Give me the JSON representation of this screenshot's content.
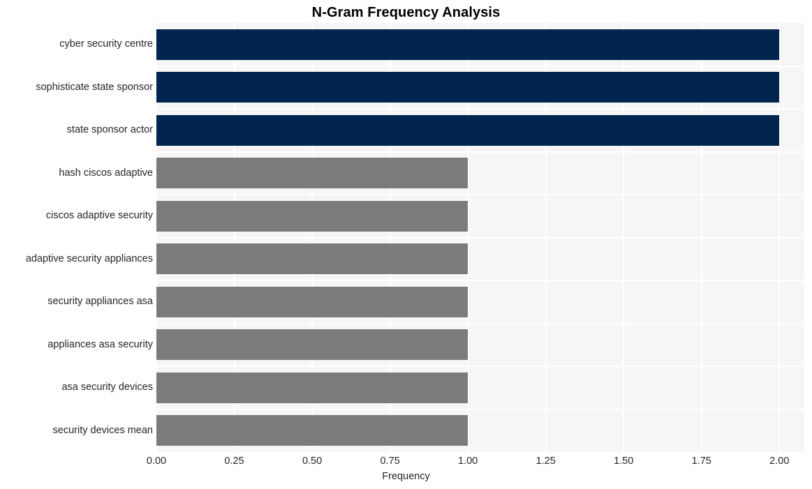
{
  "chart_data": {
    "type": "bar",
    "orientation": "horizontal",
    "title": "N-Gram Frequency Analysis",
    "xlabel": "Frequency",
    "ylabel": "",
    "categories": [
      "cyber security centre",
      "sophisticate state sponsor",
      "state sponsor actor",
      "hash ciscos adaptive",
      "ciscos adaptive security",
      "adaptive security appliances",
      "security appliances asa",
      "appliances asa security",
      "asa security devices",
      "security devices mean"
    ],
    "values": [
      2,
      2,
      2,
      1,
      1,
      1,
      1,
      1,
      1,
      1
    ],
    "bar_colors": [
      "#01254f",
      "#01254f",
      "#01254f",
      "#7b7b79",
      "#7b7b79",
      "#7b7b79",
      "#7b7b79",
      "#7b7b79",
      "#7b7b79",
      "#7b7b79"
    ],
    "xlim": [
      0.0,
      2.08
    ],
    "ylim": [
      0,
      10
    ],
    "xticks": [
      0.0,
      0.25,
      0.5,
      0.75,
      1.0,
      1.25,
      1.5,
      1.75,
      2.0
    ],
    "xticklabels": [
      "0.00",
      "0.25",
      "0.50",
      "0.75",
      "1.00",
      "1.25",
      "1.50",
      "1.75",
      "2.00"
    ],
    "grid": true,
    "grid_color": "#ffffff",
    "plot_background": "#f6f6f6",
    "figure_background": "#ffffff",
    "legend": null,
    "legend_position": "none",
    "accent_color_primary": "#01254f",
    "accent_color_secondary": "#7b7b79",
    "text_color": "#262626",
    "title_color": "#000000"
  }
}
